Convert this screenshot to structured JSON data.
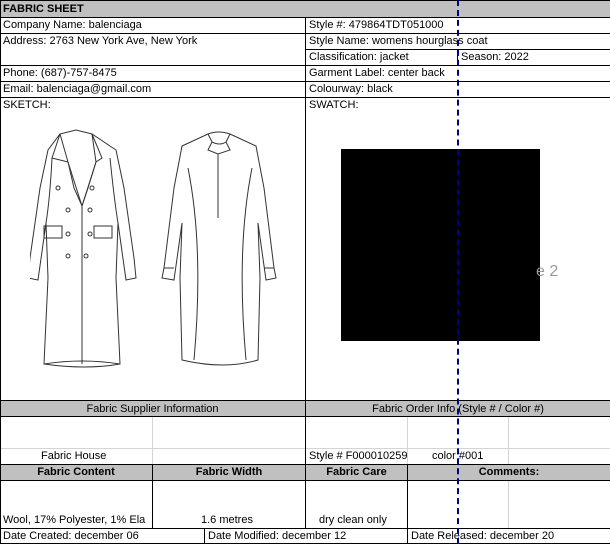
{
  "sheet": {
    "title": "FABRIC SHEET",
    "company_name": "Company Name: balenciaga",
    "address": "Address: 2763 New York Ave, New York",
    "phone": "Phone:  (687)-757-8475",
    "email": "Email: balenciaga@gmail.com",
    "sketch_label": "SKETCH:",
    "style_no": "Style #: 479864TDT051000",
    "style_name": "Style Name: womens hourglass coat",
    "classification": "Classification: jacket",
    "season": "Season: 2022",
    "garment_label": "Garment Label: center back",
    "colourway": "Colourway: black",
    "swatch_label": "SWATCH:",
    "watermark": "e 2",
    "swatch_color": "#000000"
  },
  "supplier": {
    "header": "Fabric Supplier Information",
    "name": "Fabric House"
  },
  "order": {
    "header": "Fabric Order Info (Style # / Color #)",
    "style": "Style # F000010259",
    "color": "color #001"
  },
  "fabric": {
    "headers": {
      "content": "Fabric Content",
      "width": "Fabric Width",
      "care": "Fabric Care",
      "comments": "Comments:"
    },
    "content": "Wool, 17% Polyester, 1% Ela",
    "width": "1.6 metres",
    "care": "dry clean only"
  },
  "dates": {
    "created": "Date Created: december 06",
    "modified": "Date Modified: december 12",
    "released": "Date Released: december 20"
  },
  "colors": {
    "header_fill": "#c0c0c0",
    "page_break": "#00008b",
    "gridline": "#d4d4d4"
  }
}
